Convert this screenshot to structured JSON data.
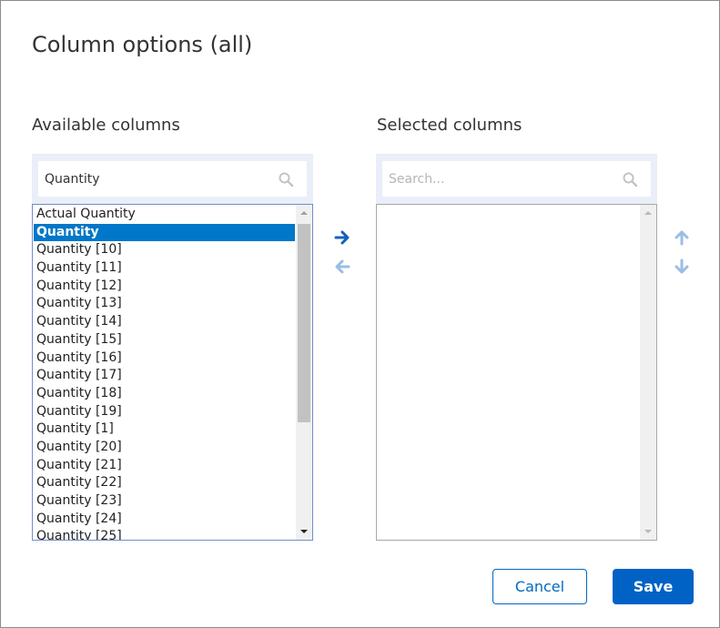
{
  "dialog": {
    "title": "Column options (all)",
    "available": {
      "label": "Available columns",
      "search_value": "Quantity",
      "search_placeholder": "Search...",
      "items": [
        {
          "label": "Actual Quantity",
          "selected": false
        },
        {
          "label": "Quantity",
          "selected": true
        },
        {
          "label": "Quantity [10]",
          "selected": false
        },
        {
          "label": "Quantity [11]",
          "selected": false
        },
        {
          "label": "Quantity [12]",
          "selected": false
        },
        {
          "label": "Quantity [13]",
          "selected": false
        },
        {
          "label": "Quantity [14]",
          "selected": false
        },
        {
          "label": "Quantity [15]",
          "selected": false
        },
        {
          "label": "Quantity [16]",
          "selected": false
        },
        {
          "label": "Quantity [17]",
          "selected": false
        },
        {
          "label": "Quantity [18]",
          "selected": false
        },
        {
          "label": "Quantity [19]",
          "selected": false
        },
        {
          "label": "Quantity [1]",
          "selected": false
        },
        {
          "label": "Quantity [20]",
          "selected": false
        },
        {
          "label": "Quantity [21]",
          "selected": false
        },
        {
          "label": "Quantity [22]",
          "selected": false
        },
        {
          "label": "Quantity [23]",
          "selected": false
        },
        {
          "label": "Quantity [24]",
          "selected": false
        },
        {
          "label": "Quantity [25]",
          "selected": false
        }
      ]
    },
    "selected": {
      "label": "Selected columns",
      "search_value": "",
      "search_placeholder": "Search...",
      "items": []
    },
    "icons": {
      "move_right": "arrow-right-icon",
      "move_left": "arrow-left-icon",
      "move_up": "arrow-up-icon",
      "move_down": "arrow-down-icon",
      "search": "search-icon"
    },
    "colors": {
      "accent": "#0062c4",
      "selection": "#0077c8",
      "arrow_active": "#1560bd",
      "arrow_inactive": "#9bbce6",
      "panel_bg": "#e9eef8"
    },
    "buttons": {
      "cancel_label": "Cancel",
      "save_label": "Save"
    }
  }
}
